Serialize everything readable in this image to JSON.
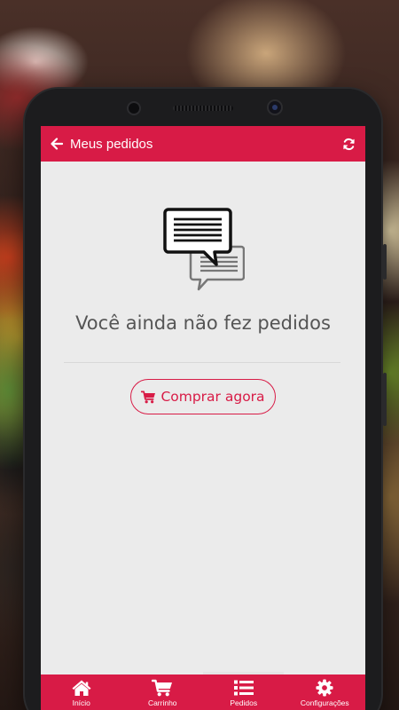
{
  "header": {
    "title": "Meus pedidos",
    "back_icon": "arrow-left-icon",
    "refresh_icon": "refresh-icon"
  },
  "empty_state": {
    "illustration_icon": "chat-bubbles-icon",
    "message": "Você ainda não fez pedidos",
    "button_label": "Comprar agora",
    "button_icon": "cart-icon"
  },
  "tabs": [
    {
      "label": "Início",
      "icon": "home-icon"
    },
    {
      "label": "Carrinho",
      "icon": "cart-icon"
    },
    {
      "label": "Pedidos",
      "icon": "list-icon"
    },
    {
      "label": "Configurações",
      "icon": "gear-icon"
    }
  ],
  "colors": {
    "accent": "#d81b46",
    "background": "#ebebeb",
    "text": "#555555"
  }
}
